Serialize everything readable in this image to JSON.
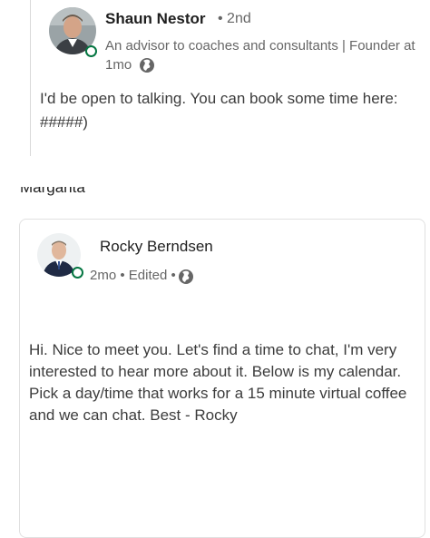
{
  "comment1": {
    "author_name": "Shaun Nestor",
    "connection_degree": "• 2nd",
    "headline": "An advisor to coaches and consultants | Founder at",
    "time": "1mo",
    "visibility_icon": "globe-icon",
    "text_line1": "I'd be open to talking. You can book some time here:",
    "text_line2": "#####)"
  },
  "between": {
    "clipped_name": "Margarita"
  },
  "comment2": {
    "author_name": "Rocky Berndsen",
    "meta": "2mo • Edited •",
    "visibility_icon": "globe-icon",
    "text": "Hi. Nice to meet you. Let's find a time to chat, I'm very interested to hear more about it. Below is my calendar. Pick a day/time that works for a 15 minute virtual coffee and we can chat. Best - Rocky"
  },
  "colors": {
    "presence_green": "#057642",
    "secondary_text": "#666666",
    "body_text": "#3c3c3c",
    "card_border": "#e0e0e0"
  }
}
